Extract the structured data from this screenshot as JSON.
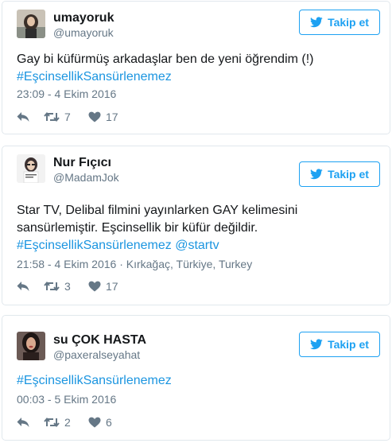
{
  "colors": {
    "accent": "#1da1f2",
    "link": "#1b95e0",
    "muted": "#657786",
    "border": "#e1e8ed",
    "text": "#14171a"
  },
  "follow_icon": "twitter-bird-icon",
  "tweets": [
    {
      "name": "umayoruk",
      "handle": "@umayoruk",
      "follow_label": "Takip et",
      "text_line1": "Gay bi küfürmüş arkadaşlar ben de yeni öğrendim (!)",
      "hashtag": "#EşcinsellikSansürlenemez",
      "timestamp": "23:09 - 4 Ekim 2016",
      "retweets": "7",
      "likes": "17"
    },
    {
      "name": "Nur Fıçıcı",
      "handle": "@MadamJok",
      "follow_label": "Takip et",
      "text_line1": "Star TV, Delibal filmini yayınlarken GAY kelimesini",
      "text_line2": "sansürlemiştir. Eşcinsellik bir küfür değildir.",
      "hashtag": "#EşcinsellikSansürlenemez",
      "mention": "@startv",
      "timestamp": "21:58 - 4 Ekim 2016",
      "location_sep": "·",
      "location": "Kırkağaç, Türkiye, Turkey",
      "retweets": "3",
      "likes": "17"
    },
    {
      "name": "su ÇOK HASTA",
      "handle": "@paxeralseyahat",
      "follow_label": "Takip et",
      "hashtag": "#EşcinsellikSansürlenemez",
      "timestamp": "00:03 - 5 Ekim 2016",
      "retweets": "2",
      "likes": "6"
    }
  ]
}
